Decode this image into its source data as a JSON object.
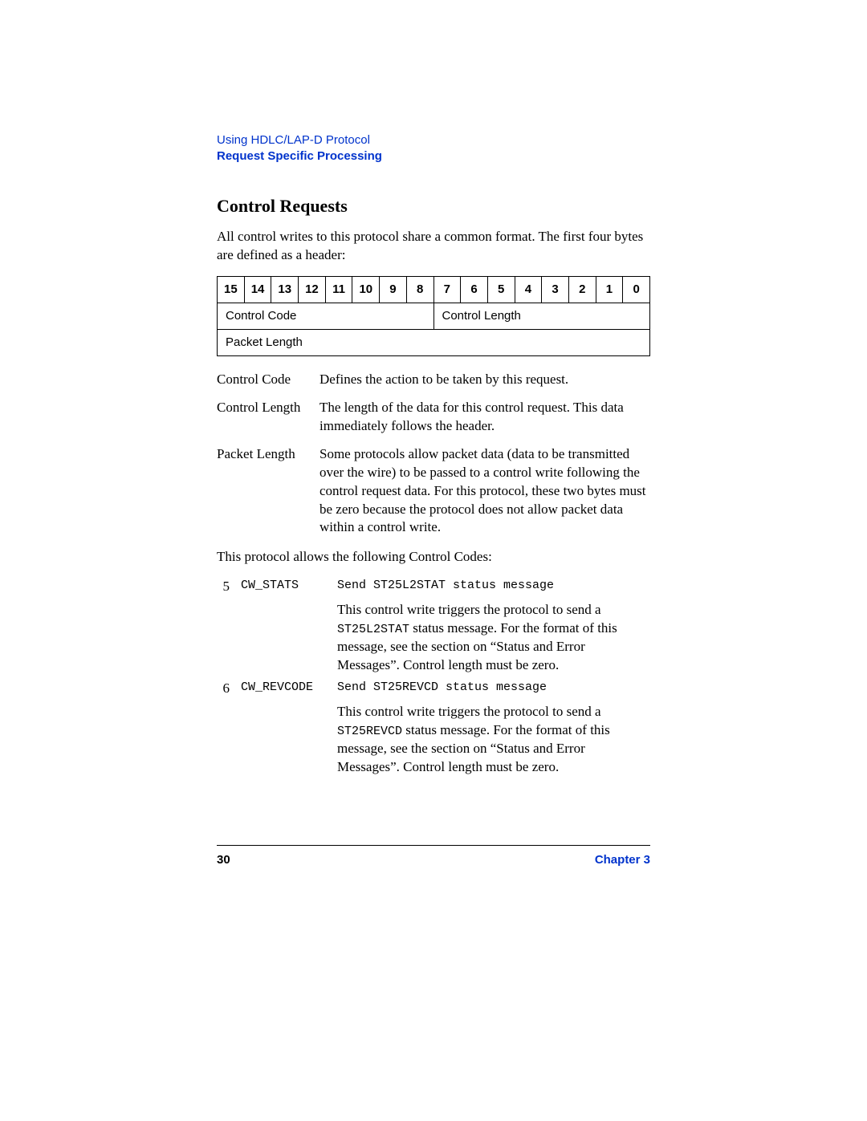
{
  "header": {
    "line1": "Using HDLC/LAP-D Protocol",
    "line2": "Request Specific Processing"
  },
  "heading": "Control Requests",
  "intro": "All control writes to this protocol share a common format. The first four bytes are defined as a header:",
  "bits": [
    "15",
    "14",
    "13",
    "12",
    "11",
    "10",
    "9",
    "8",
    "7",
    "6",
    "5",
    "4",
    "3",
    "2",
    "1",
    "0"
  ],
  "bitrow1": {
    "left": "Control Code",
    "right": "Control Length"
  },
  "bitrow2": "Packet Length",
  "defs": [
    {
      "term": "Control Code",
      "def": "Defines the action to be taken by this request."
    },
    {
      "term": "Control Length",
      "def": "The length of the data for this control request. This data immediately follows the header."
    },
    {
      "term": "Packet Length",
      "def": "Some protocols allow packet data (data to be transmitted over the wire) to be passed to a control write following the control request data. For this protocol, these two bytes must be zero because the protocol does not allow packet data within a control write."
    }
  ],
  "codes_intro": "This protocol allows the following Control Codes:",
  "codes": [
    {
      "num": "5",
      "name": "CW_STATS",
      "short": "Send ST25L2STAT status message",
      "desc_pre": "This control write triggers the protocol to send a ",
      "desc_mono": "ST25L2STAT",
      "desc_post": " status message. For the format of this message, see the section on “Status and Error Messages”. Control length must be zero."
    },
    {
      "num": "6",
      "name": "CW_REVCODE",
      "short": "Send ST25REVCD status message",
      "desc_pre": "This control write triggers the protocol to send a ",
      "desc_mono": "ST25REVCD",
      "desc_post": " status message. For the format of this message, see the section on “Status and Error Messages”. Control length must be zero."
    }
  ],
  "footer": {
    "page": "30",
    "chapter": "Chapter 3"
  }
}
